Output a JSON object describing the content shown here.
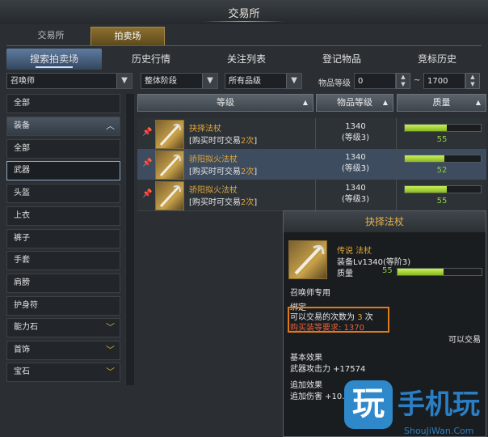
{
  "window": {
    "title": "交易所"
  },
  "main_tabs": [
    {
      "label": "交易所"
    },
    {
      "label": "拍卖场"
    }
  ],
  "sub_tabs": [
    {
      "label": "搜索拍卖场"
    },
    {
      "label": "历史行情"
    },
    {
      "label": "关注列表"
    },
    {
      "label": "登记物品"
    },
    {
      "label": "竞标历史"
    }
  ],
  "filters": {
    "class": "召唤师",
    "stage": "整体阶段",
    "grade": "所有品级",
    "item_level_label": "物品等级",
    "min_level": "0",
    "range_sep": "~",
    "max_level": "1700"
  },
  "sidebar": [
    {
      "label": "全部"
    },
    {
      "label": "装备"
    },
    {
      "label": "全部"
    },
    {
      "label": "武器"
    },
    {
      "label": "头盔"
    },
    {
      "label": "上衣"
    },
    {
      "label": "裤子"
    },
    {
      "label": "手套"
    },
    {
      "label": "肩膀"
    },
    {
      "label": "护身符"
    },
    {
      "label": "能力石"
    },
    {
      "label": "首饰"
    },
    {
      "label": "宝石"
    }
  ],
  "table": {
    "headers": {
      "level": "等级",
      "item_level": "物品等级",
      "quality": "质量"
    },
    "rows": [
      {
        "name": "抉择法杖",
        "cond_prefix": "[购买时可交易",
        "cond_num": "2次",
        "cond_suffix": "]",
        "level": "1340",
        "sub": "(等级3)",
        "quality": 55
      },
      {
        "name": "骄阳拟火法杖",
        "cond_prefix": "[购买时可交易",
        "cond_num": "2次",
        "cond_suffix": "]",
        "level": "1340",
        "sub": "(等级3)",
        "quality": 52
      },
      {
        "name": "骄阳拟火法杖",
        "cond_prefix": "[购买时可交易",
        "cond_num": "2次",
        "cond_suffix": "]",
        "level": "1340",
        "sub": "(等级3)",
        "quality": 55
      }
    ]
  },
  "tooltip": {
    "title": "抉择法杖",
    "rarity": "传说 法杖",
    "equip": "装备Lv1340(等阶3)",
    "quality_label": "质量",
    "quality": 55,
    "class_only": "召唤师专用",
    "bind": "绑定",
    "trade_prefix": "可以交易的次数为",
    "trade_num": "3",
    "trade_suffix": "次",
    "req": "购买装等要求: 1370",
    "tradable": "可以交易",
    "base_title": "基本效果",
    "base_val": "武器攻击力 +17574",
    "extra_title": "追加效果",
    "extra_val": "追加伤害 +10."
  },
  "watermark": {
    "icon": "玩",
    "text": "手机玩",
    "url": "ShouJiWan.Com"
  }
}
